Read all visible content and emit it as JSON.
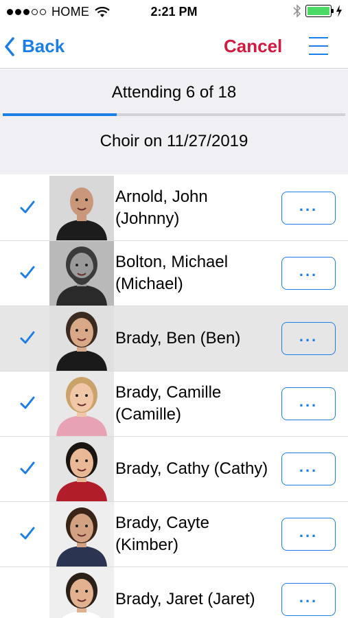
{
  "status_bar": {
    "carrier": "HOME",
    "time": "2:21 PM",
    "signal_dots": [
      true,
      true,
      true,
      false,
      false
    ]
  },
  "nav": {
    "back_label": "Back",
    "cancel_label": "Cancel",
    "menu_icon": "hamburger-menu-icon"
  },
  "attendance": {
    "text": "Attending 6 of 18",
    "progress_fraction": 0.333
  },
  "event": {
    "title": "Choir on 11/27/2019"
  },
  "colors": {
    "accent": "#1a7ee6",
    "cancel": "#d3193f",
    "battery": "#4cd964",
    "header_bg": "#efeff4"
  },
  "people": [
    {
      "line1": "Arnold, John",
      "line2": "(Johnny)",
      "checked": true,
      "highlighted": false,
      "more_label": "..."
    },
    {
      "line1": "Bolton, Michael",
      "line2": "(Michael)",
      "checked": true,
      "highlighted": false,
      "more_label": "..."
    },
    {
      "line1": "Brady, Ben (Ben)",
      "line2": "",
      "checked": true,
      "highlighted": true,
      "more_label": "..."
    },
    {
      "line1": "Brady, Camille",
      "line2": "(Camille)",
      "checked": true,
      "highlighted": false,
      "more_label": "..."
    },
    {
      "line1": "Brady, Cathy (Cathy)",
      "line2": "",
      "checked": true,
      "highlighted": false,
      "more_label": "..."
    },
    {
      "line1": "Brady, Cayte",
      "line2": "(Kimber)",
      "checked": true,
      "highlighted": false,
      "more_label": "..."
    },
    {
      "line1": "Brady, Jaret (Jaret)",
      "line2": "",
      "checked": false,
      "highlighted": false,
      "more_label": "..."
    }
  ]
}
